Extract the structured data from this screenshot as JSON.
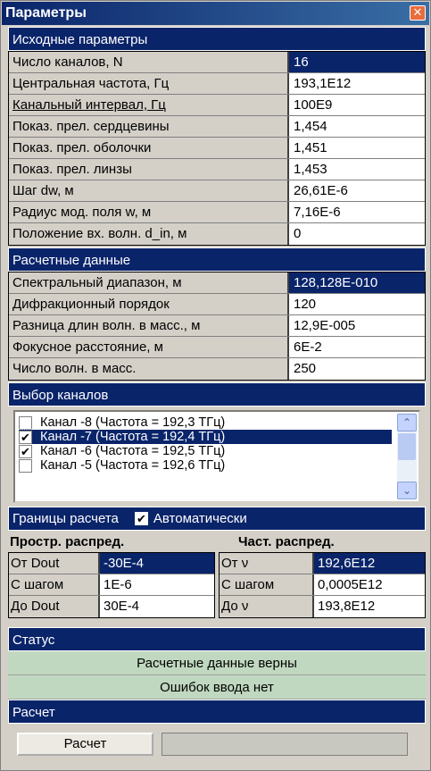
{
  "window": {
    "title": "Параметры",
    "close_glyph": "✕"
  },
  "initial": {
    "header": "Исходные параметры",
    "rows": [
      {
        "label": "Число каналов, N",
        "value": "16"
      },
      {
        "label": "Центральная частота, Гц",
        "value": "193,1E12"
      },
      {
        "label": "Канальный интервал, Гц",
        "value": "100E9"
      },
      {
        "label": "Показ. прел. сердцевины",
        "value": "1,454"
      },
      {
        "label": "Показ. прел. оболочки",
        "value": "1,451"
      },
      {
        "label": "Показ. прел. линзы",
        "value": "1,453"
      },
      {
        "label": "Шаг dw, м",
        "value": "26,61E-6"
      },
      {
        "label": "Радиус мод. поля w, м",
        "value": "7,16E-6"
      },
      {
        "label": "Положение вх. волн. d_in, м",
        "value": "0"
      }
    ]
  },
  "computed": {
    "header": "Расчетные данные",
    "rows": [
      {
        "label": "Спектральный диапазон, м",
        "value": "128,128E-010"
      },
      {
        "label": "Дифракционный порядок",
        "value": "120"
      },
      {
        "label": "Разница длин волн. в масс., м",
        "value": "12,9E-005"
      },
      {
        "label": "Фокусное расстояние, м",
        "value": "6E-2"
      },
      {
        "label": "Число волн. в масс.",
        "value": "250"
      }
    ]
  },
  "channels": {
    "header": "Выбор каналов",
    "items": [
      {
        "label": "Канал -8 (Частота = 192,3 ТГц)",
        "checked": false
      },
      {
        "label": "Канал -7 (Частота = 192,4 ТГц)",
        "checked": true
      },
      {
        "label": "Канал -6 (Частота = 192,5 ТГц)",
        "checked": true
      },
      {
        "label": "Канал -5 (Частота = 192,6 ТГц)",
        "checked": false
      }
    ],
    "check_glyph": "✔",
    "up_glyph": "⌃",
    "down_glyph": "⌄"
  },
  "bounds": {
    "header": "Границы расчета",
    "auto_label": "Автоматически",
    "auto_checked": true,
    "spatial_title": "Простр. распред.",
    "freq_title": "Част. распред.",
    "spatial_rows": [
      {
        "label": "От Dout",
        "value": "-30E-4"
      },
      {
        "label": "С шагом",
        "value": "1E-6"
      },
      {
        "label": "До Dout",
        "value": "30E-4"
      }
    ],
    "freq_rows": [
      {
        "label": "От ν",
        "value": "192,6E12"
      },
      {
        "label": "С шагом",
        "value": "0,0005E12"
      },
      {
        "label": "До ν",
        "value": "193,8E12"
      }
    ]
  },
  "status": {
    "header": "Статус",
    "lines": [
      "Расчетные данные верны",
      "Ошибок ввода нет"
    ]
  },
  "calc": {
    "header": "Расчет",
    "button": "Расчет"
  }
}
